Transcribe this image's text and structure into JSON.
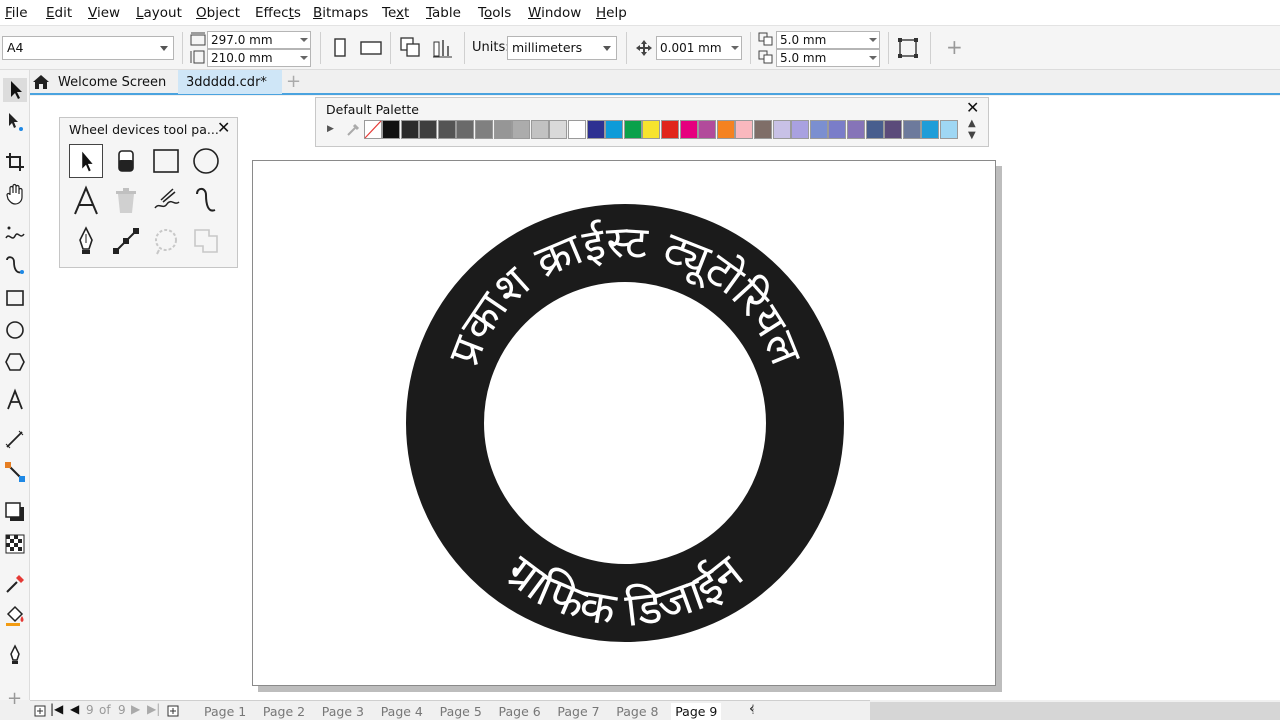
{
  "menu": [
    "File",
    "Edit",
    "View",
    "Layout",
    "Object",
    "Effects",
    "Bitmaps",
    "Text",
    "Table",
    "Tools",
    "Window",
    "Help"
  ],
  "menu_underline": [
    "F",
    "E",
    "V",
    "L",
    "O",
    "t",
    "B",
    "x",
    "T",
    "o",
    "W",
    "H"
  ],
  "propbar": {
    "page_size": "A4",
    "width": "297.0 mm",
    "height": "210.0 mm",
    "units_label": "Units:",
    "units": "millimeters",
    "nudge": "0.001 mm",
    "dup_x": "5.0 mm",
    "dup_y": "5.0 mm"
  },
  "tabs": {
    "welcome": "Welcome Screen",
    "document": "3ddddd.cdr*"
  },
  "palette": {
    "title": "Default Palette",
    "colors": [
      "#111111",
      "#2b2b2b",
      "#3f3f3f",
      "#545454",
      "#6a6a6a",
      "#808080",
      "#969696",
      "#acacac",
      "#c2c2c2",
      "#d9d9d9",
      "#ffffff",
      "#2e3192",
      "#0e9bd8",
      "#0aa14b",
      "#f7e32e",
      "#e1251b",
      "#e6007e",
      "#b24b9b",
      "#f58220",
      "#f9b8be",
      "#7f6e68",
      "#c8c1e6",
      "#a9a1e0",
      "#7b8fd0",
      "#7a7dc9",
      "#8674b8",
      "#485e8e",
      "#5b4b7a",
      "#6d7a9c",
      "#1e9dd8",
      "#9fd7f4"
    ]
  },
  "wheel": {
    "title": "Wheel devices tool pa..."
  },
  "artwork": {
    "top_text": "प्रकाश क्राईस्ट ट्यूटोरियल",
    "bottom_text": "ग्राफिक डिजाईन",
    "ring_color": "#1b1b1b"
  },
  "pager": {
    "counter": "9",
    "of": "of",
    "total": "9",
    "pages": [
      "Page 1",
      "Page 2",
      "Page 3",
      "Page 4",
      "Page 5",
      "Page 6",
      "Page 7",
      "Page 8",
      "Page 9"
    ],
    "active": "Page 9"
  }
}
